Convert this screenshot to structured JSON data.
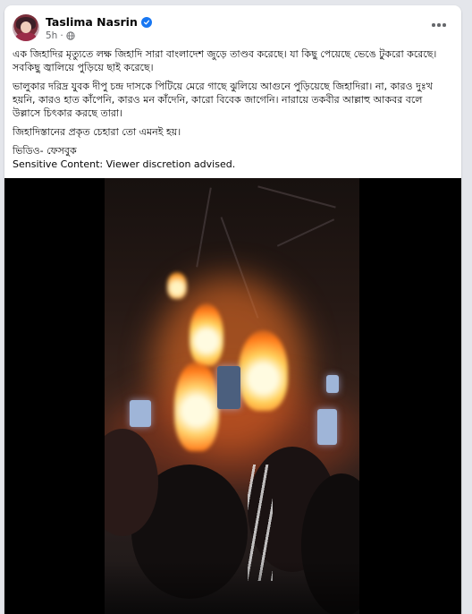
{
  "post": {
    "author": "Taslima Nasrin",
    "time": "5h",
    "dot": "·",
    "paragraphs": [
      "এক জিহাদির মৃত্যুতে লক্ষ জিহাদি সারা বাংলাদেশ জুড়ে তাণ্ডব করেছে। যা কিছু পেয়েছে ভেঙে টুকরো করেছে। সবকিছু জ্বালিয়ে পুড়িয়ে ছাই করেছে।",
      "ভালুকার দরিদ্র যুবক দীপু চন্দ্র দাসকে পিটিয়ে মেরে গাছে ঝুলিয়ে আগুনে পুড়িয়েছে জিহাদিরা। না, কারও দুঃখ হয়নি, কারও হাত কাঁপেনি, কারও মন কাঁদেনি, কারো বিবেক জাগেনি। নারায়ে তকবীর আল্লাহু আকবর বলে উল্লাসে চিৎকার করছে তারা।",
      "জিহাদিস্তানের প্রকৃত চেহারা তো এমনই হয়।"
    ],
    "source": "ভিডিও- ফেসবুক",
    "warning": "Sensitive Content: Viewer discretion advised."
  },
  "icons": {
    "verified": "verified-badge-icon",
    "audience": "globe-icon",
    "more": "more-options-icon"
  },
  "colors": {
    "background": "#e4e6eb",
    "card": "#ffffff",
    "verified": "#1877f2",
    "meta_text": "#65676b"
  }
}
